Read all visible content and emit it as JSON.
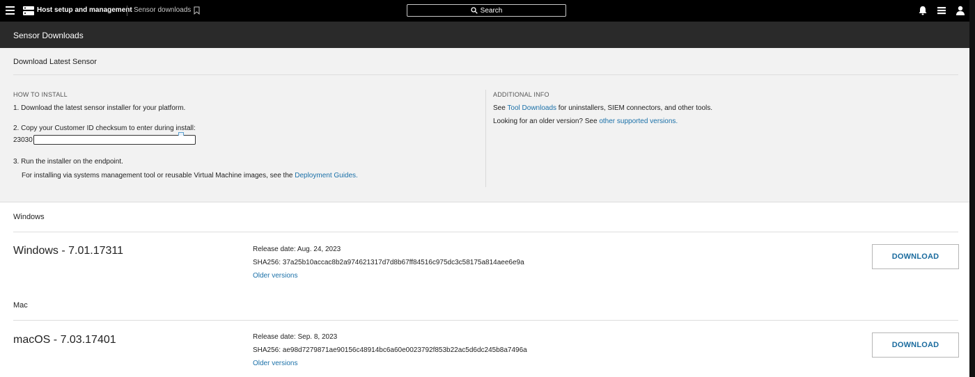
{
  "topbar": {
    "breadcrumb_primary": "Host setup and management",
    "breadcrumb_secondary": "Sensor downloads",
    "search_label": "Search",
    "icons": [
      "menu-icon",
      "app-icon",
      "bookmark-icon",
      "search-icon",
      "bell-icon",
      "inbox-icon",
      "user-icon"
    ]
  },
  "header": {
    "title": "Sensor Downloads"
  },
  "install": {
    "title": "Download Latest Sensor",
    "how_to": {
      "heading": "HOW TO INSTALL",
      "step1": "1. Download the latest sensor installer for your platform.",
      "step2": "2. Copy your Customer ID checksum to enter during install:",
      "checksum_prefix": "23030",
      "step3": "3. Run the installer on the endpoint.",
      "step3_detail": "For installing via systems management tool or reusable Virtual Machine images, see the",
      "deployment_link": "Deployment Guides."
    },
    "additional": {
      "heading": "ADDITIONAL INFO",
      "line1_pre": "See",
      "tool_link": "Tool Downloads",
      "line1_post": "for uninstallers, SIEM connectors, and other tools.",
      "line2_pre": "Looking for an older version? See",
      "versions_link": "other supported versions."
    }
  },
  "downloads": [
    {
      "section": "Windows",
      "product": "Windows - 7.01.17311",
      "release_date": "Release date: Aug. 24, 2023",
      "sha": "SHA256: 37a25b10accac8b2a974621317d7d8b67ff84516c975dc3c58175a814aee6e9a",
      "older_link": "Older versions",
      "button": "DOWNLOAD"
    },
    {
      "section": "Mac",
      "product": "macOS - 7.03.17401",
      "release_date": "Release date: Sep. 8, 2023",
      "sha": "SHA256: ae98d7279871ae90156c48914bc6a60e0023792f853b22ac5d6dc245b8a7496a",
      "older_link": "Older versions",
      "button": "DOWNLOAD"
    }
  ],
  "colors": {
    "topbar_bg": "#000000",
    "header_bg": "#2a2a2a",
    "panel_bg": "#f2f2f2",
    "link": "#1a70a8",
    "button_text": "#1a6b9e"
  }
}
